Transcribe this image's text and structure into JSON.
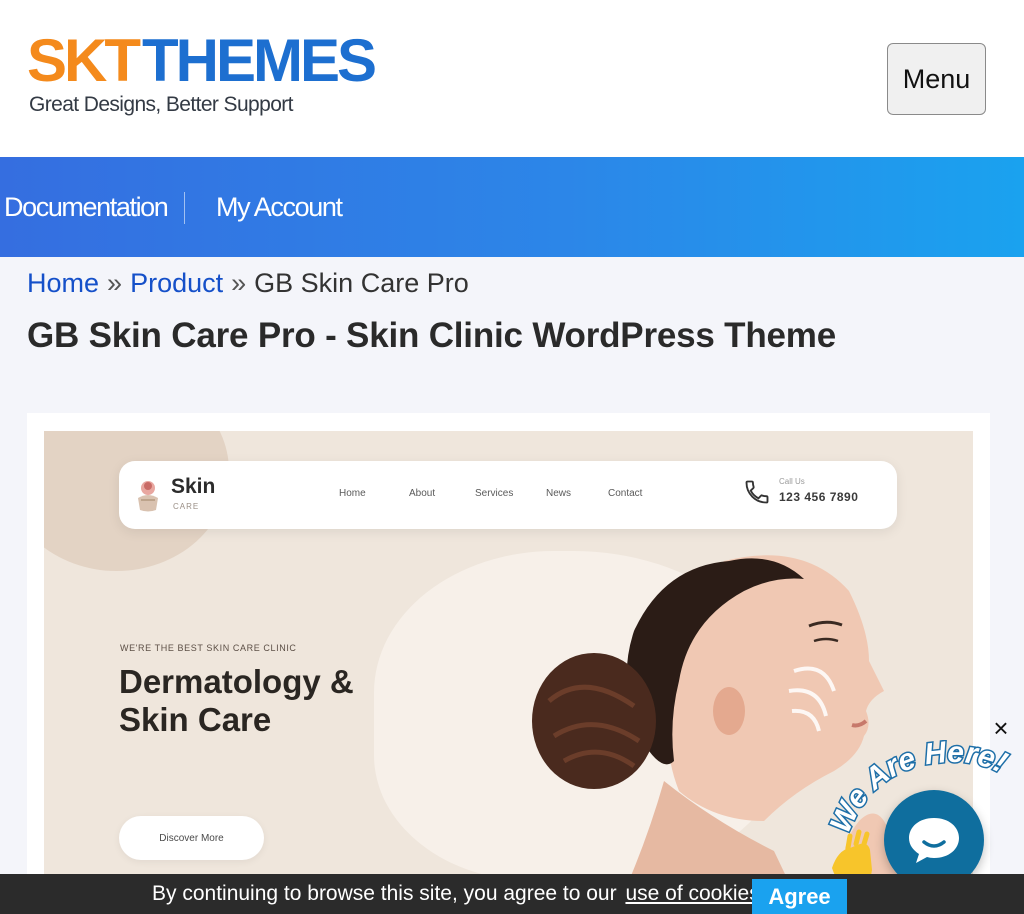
{
  "header": {
    "logo_part1": "SKT",
    "logo_part2": "THEMES",
    "tagline": "Great Designs, Better Support",
    "menu_label": "Menu"
  },
  "nav": {
    "items": [
      {
        "label": "Documentation"
      },
      {
        "label": "My Account"
      }
    ]
  },
  "breadcrumb": {
    "home": "Home",
    "separator": "»",
    "product": "Product",
    "current": "GB Skin Care Pro"
  },
  "page_title": "GB Skin Care Pro - Skin Clinic WordPress Theme",
  "preview": {
    "logo_name": "Skin",
    "logo_sub": "CARE",
    "menu": [
      "Home",
      "About",
      "Services",
      "News",
      "Contact"
    ],
    "call_label": "Call Us",
    "phone": "123 456 7890",
    "tagline": "WE'RE THE BEST SKIN CARE CLINIC",
    "hero_line1": "Dermatology &",
    "hero_line2": "Skin Care",
    "cta": "Discover More"
  },
  "chat": {
    "close_label": "×",
    "badge_text": "We Are Here!",
    "brand_color": "#0f6e9e"
  },
  "cookie": {
    "text_before": "By continuing to browse this site, you agree to our",
    "link_text": "use of cookies",
    "text_after": ".",
    "agree_label": "Agree"
  },
  "colors": {
    "logo_orange": "#f48a1c",
    "logo_blue": "#1d6fd0",
    "nav_gradient_start": "#356ee0",
    "nav_gradient_end": "#1aa2ef",
    "link_blue": "#1550c9",
    "agree_blue": "#1aa2ef"
  }
}
